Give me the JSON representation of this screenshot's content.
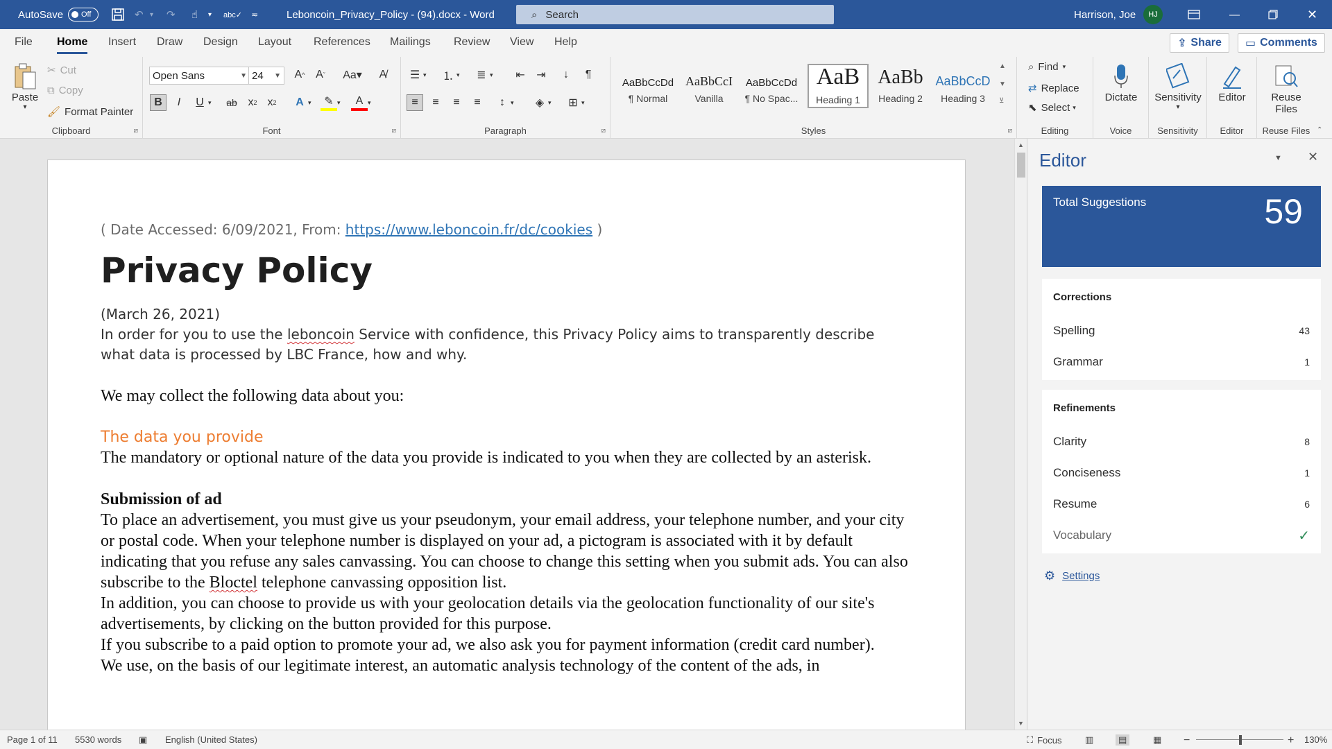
{
  "titlebar": {
    "autosave_label": "AutoSave",
    "autosave_state": "Off",
    "doc_title": "Leboncoin_Privacy_Policy - (94).docx - Word",
    "search_placeholder": "Search",
    "user_name": "Harrison, Joe",
    "user_initials": "HJ"
  },
  "tabs": [
    "File",
    "Home",
    "Insert",
    "Draw",
    "Design",
    "Layout",
    "References",
    "Mailings",
    "Review",
    "View",
    "Help"
  ],
  "header_buttons": {
    "share": "Share",
    "comments": "Comments"
  },
  "ribbon": {
    "clipboard": {
      "paste": "Paste",
      "cut": "Cut",
      "copy": "Copy",
      "format_painter": "Format Painter",
      "label": "Clipboard"
    },
    "font": {
      "name": "Open Sans",
      "size": "24",
      "label": "Font"
    },
    "paragraph": {
      "label": "Paragraph"
    },
    "styles": {
      "label": "Styles",
      "items": [
        {
          "preview": "AaBbCcDd",
          "name": "¶ Normal"
        },
        {
          "preview": "AaBbCcI",
          "name": "Vanilla"
        },
        {
          "preview": "AaBbCcDd",
          "name": "¶ No Spac..."
        },
        {
          "preview": "AaB",
          "name": "Heading 1"
        },
        {
          "preview": "AaBb",
          "name": "Heading 2"
        },
        {
          "preview": "AaBbCcD",
          "name": "Heading 3"
        }
      ]
    },
    "editing": {
      "find": "Find",
      "replace": "Replace",
      "select": "Select",
      "label": "Editing"
    },
    "voice": {
      "dictate": "Dictate",
      "label": "Voice"
    },
    "sensitivity": {
      "button": "Sensitivity",
      "label": "Sensitivity"
    },
    "editor_group": {
      "button": "Editor",
      "label": "Editor"
    },
    "reuse": {
      "button_line1": "Reuse",
      "button_line2": "Files",
      "label": "Reuse Files"
    }
  },
  "document": {
    "access_prefix": "( Date Accessed: 6/09/2021, From: ",
    "access_link": "https://www.leboncoin.fr/dc/cookies",
    "access_suffix": " )",
    "title": "Privacy Policy",
    "date": "(March 26, 2021)",
    "intro_a": "In order for you to use the ",
    "intro_mis": "leboncoin",
    "intro_b": " Service with confidence, this Privacy Policy aims to transparently describe what data is processed by LBC France, how and why.",
    "collect": "We may collect the following data about you:",
    "section_heading": "The data you provide",
    "mandatory": "The mandatory or optional nature of the data you provide is indicated to you when they are collected by an asterisk.",
    "sub_heading": "Submission of ad",
    "ad_para_a": "To place an advertisement, you must give us your pseudonym, your email address, your telephone number, and your city or postal code. When your telephone number is displayed on your ad, a pictogram is associated with it by default indicating that you refuse any sales canvassing. You can choose to change this setting when you submit ads. You can also subscribe to the ",
    "ad_para_mis": "Bloctel",
    "ad_para_b": " telephone canvassing opposition list.",
    "geo_para": "In addition, you can choose to provide us with your geolocation details via the geolocation functionality of our site's advertisements, by clicking on the button provided for this purpose.",
    "pay_para": "If you subscribe to a paid option to promote your ad, we also ask you for payment information (credit card number).",
    "last_para": "We use, on the basis of our legitimate interest, an automatic analysis technology of the content of the ads, in"
  },
  "editor": {
    "title": "Editor",
    "total_label": "Total Suggestions",
    "total_count": "59",
    "corrections_label": "Corrections",
    "corrections": [
      {
        "name": "Spelling",
        "count": "43"
      },
      {
        "name": "Grammar",
        "count": "1"
      }
    ],
    "refinements_label": "Refinements",
    "refinements": [
      {
        "name": "Clarity",
        "count": "8"
      },
      {
        "name": "Conciseness",
        "count": "1"
      },
      {
        "name": "Resume",
        "count": "6"
      },
      {
        "name": "Vocabulary",
        "count": ""
      }
    ],
    "settings": "Settings"
  },
  "status": {
    "page": "Page 1 of 11",
    "words": "5530 words",
    "language": "English (United States)",
    "focus": "Focus",
    "zoom_minus": "−",
    "zoom_plus": "+",
    "zoom": "130%"
  },
  "colors": {
    "brand": "#2b579a",
    "accent_orange": "#ed7d31",
    "link": "#2e74b5"
  }
}
